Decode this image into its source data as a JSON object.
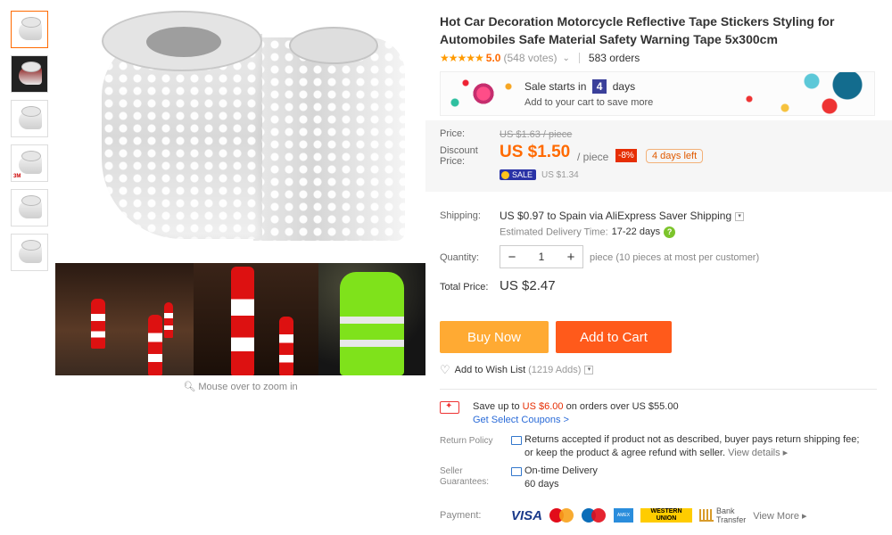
{
  "thumbnails": [
    {
      "name": "thumb-1"
    },
    {
      "name": "thumb-2"
    },
    {
      "name": "thumb-3"
    },
    {
      "name": "thumb-4",
      "label": "3M"
    },
    {
      "name": "thumb-5"
    },
    {
      "name": "thumb-6"
    }
  ],
  "zoom_hint": "Mouse over to zoom in",
  "product": {
    "title": "Hot Car Decoration Motorcycle Reflective Tape Stickers Styling for Automobiles Safe Material Safety Warning Tape 5x300cm",
    "stars": "★★★★★",
    "rating": "5.0",
    "votes": "(548 votes)",
    "orders": "583 orders"
  },
  "sale_banner": {
    "prefix": "Sale starts in",
    "days_num": "4",
    "suffix": "days",
    "subtext": "Add to your cart to save more"
  },
  "price": {
    "price_label": "Price:",
    "original": "US $1.63 / piece",
    "discount_label_1": "Discount",
    "discount_label_2": "Price:",
    "discount_value": "US $1.50",
    "per_piece": "/ piece",
    "percent": "-8%",
    "days_left": "4 days left",
    "sale_badge": "SALE",
    "sale_price": "US $1.34"
  },
  "shipping": {
    "label": "Shipping:",
    "text": "US $0.97 to Spain via AliExpress Saver Shipping",
    "est_label": "Estimated Delivery Time:",
    "est_days": "17-22 days",
    "help_icon": "?"
  },
  "quantity": {
    "label": "Quantity:",
    "value": "1",
    "note": "piece (10 pieces at most per customer)"
  },
  "total": {
    "label": "Total Price:",
    "value": "US $2.47"
  },
  "buttons": {
    "buy_now": "Buy Now",
    "add_to_cart": "Add to Cart"
  },
  "wishlist": {
    "label": "Add to Wish List",
    "count": "(1219 Adds)"
  },
  "coupon": {
    "prefix": "Save up to",
    "amount": "US $6.00",
    "suffix": "on orders over US $55.00",
    "link": "Get Select Coupons >"
  },
  "return_policy": {
    "label": "Return Policy",
    "line1": "Returns accepted if product not as described, buyer pays return shipping fee;",
    "line2": "or keep the product & agree refund with seller.",
    "details": "View details ▸"
  },
  "guarantee": {
    "label_1": "Seller",
    "label_2": "Guarantees:",
    "line1": "On-time Delivery",
    "line2": "60 days"
  },
  "payment": {
    "label": "Payment:",
    "visa": "VISA",
    "mastercard": "MasterCard",
    "maestro": "Maestro",
    "amex": "AMERICAN EXPRESS",
    "western_union": "WESTERN UNION",
    "bank_1": "Bank",
    "bank_2": "Transfer",
    "view_more": "View More ▸"
  },
  "colors": {
    "accent_orange": "#ff6a00",
    "buy_now": "#ffaa33",
    "add_to_cart": "#ff5a1b",
    "link_blue": "#2a6bd8"
  }
}
